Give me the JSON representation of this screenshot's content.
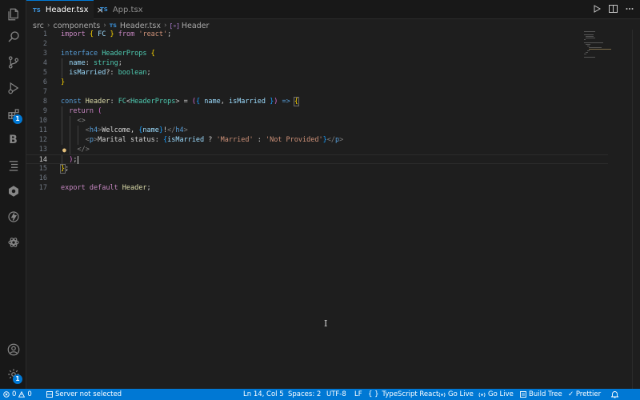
{
  "tabs": [
    {
      "lang": "TS",
      "label": "Header.tsx",
      "active": true,
      "close": "×"
    },
    {
      "lang": "TS",
      "label": "App.tsx",
      "active": false
    }
  ],
  "breadcrumb": {
    "parts": [
      "src",
      "components",
      "Header.tsx",
      "Header"
    ],
    "lang": "TS",
    "symbol_glyph": "[∘]",
    "separator": "›"
  },
  "editor": {
    "line_numbers": [
      "1",
      "2",
      "3",
      "4",
      "5",
      "6",
      "7",
      "8",
      "9",
      "10",
      "11",
      "12",
      "13",
      "14",
      "15",
      "16",
      "17"
    ],
    "current_line": 14,
    "lightbulb_line": 13
  },
  "activity_badges": {
    "extensions": "1",
    "settings": "1"
  },
  "activity_letter": "B",
  "statusbar": {
    "errors": "0",
    "warnings": "0",
    "server": "Server not selected",
    "position": "Ln 14, Col 5",
    "spaces": "Spaces: 2",
    "encoding": "UTF-8",
    "eol": "LF",
    "language_icon": "{ }",
    "language": "TypeScript React",
    "golive1": "Go Live",
    "golive2": "Go Live",
    "buildtree": "Build Tree",
    "prettier": "✓ Prettier"
  },
  "colors": {
    "accent": "#0078d4",
    "background": "#1e1e1e",
    "sidebar": "#181818"
  }
}
